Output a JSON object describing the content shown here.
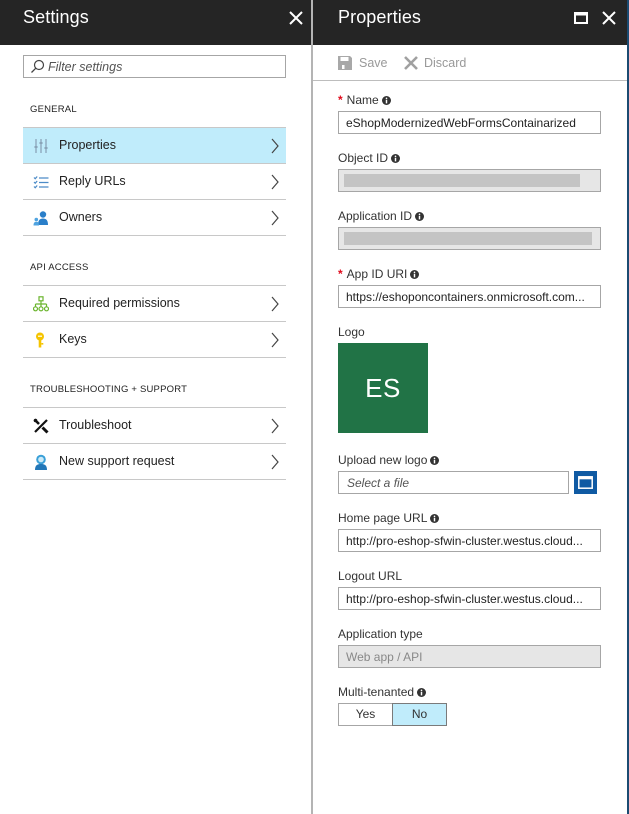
{
  "settings_blade": {
    "title": "Settings",
    "filter_placeholder": "Filter settings",
    "sections": [
      {
        "label": "GENERAL",
        "items": [
          {
            "label": "Properties",
            "icon": "sliders-icon",
            "selected": true
          },
          {
            "label": "Reply URLs",
            "icon": "checklist-icon",
            "selected": false
          },
          {
            "label": "Owners",
            "icon": "users-icon",
            "selected": false
          }
        ]
      },
      {
        "label": "API ACCESS",
        "items": [
          {
            "label": "Required permissions",
            "icon": "hierarchy-icon",
            "selected": false
          },
          {
            "label": "Keys",
            "icon": "key-icon",
            "selected": false
          }
        ]
      },
      {
        "label": "TROUBLESHOOTING + SUPPORT",
        "items": [
          {
            "label": "Troubleshoot",
            "icon": "wrench-icon",
            "selected": false
          },
          {
            "label": "New support request",
            "icon": "support-person-icon",
            "selected": false
          }
        ]
      }
    ]
  },
  "properties_blade": {
    "title": "Properties",
    "toolbar": {
      "save_label": "Save",
      "discard_label": "Discard"
    },
    "fields": {
      "name": {
        "label": "Name",
        "required": true,
        "value": "eShopModernizedWebFormsContainarized"
      },
      "object_id": {
        "label": "Object ID",
        "value": ""
      },
      "application_id": {
        "label": "Application ID",
        "value": ""
      },
      "app_id_uri": {
        "label": "App ID URI",
        "required": true,
        "value": "https://eshoponcontainers.onmicrosoft.com..."
      },
      "logo": {
        "label": "Logo",
        "initials": "ES"
      },
      "upload_logo": {
        "label": "Upload new logo",
        "placeholder": "Select a file"
      },
      "home_page_url": {
        "label": "Home page URL",
        "value": "http://pro-eshop-sfwin-cluster.westus.cloud..."
      },
      "logout_url": {
        "label": "Logout URL",
        "value": "http://pro-eshop-sfwin-cluster.westus.cloud..."
      },
      "application_type": {
        "label": "Application type",
        "value": "Web app / API"
      },
      "multi_tenanted": {
        "label": "Multi-tenanted",
        "options": [
          "Yes",
          "No"
        ],
        "selected": "No"
      }
    }
  },
  "colors": {
    "header_bg": "#252525",
    "selected_bg": "#c0ecfb",
    "logo_bg": "#217346",
    "required": "#e00b1c",
    "browse_btn": "#0f5aa3"
  }
}
